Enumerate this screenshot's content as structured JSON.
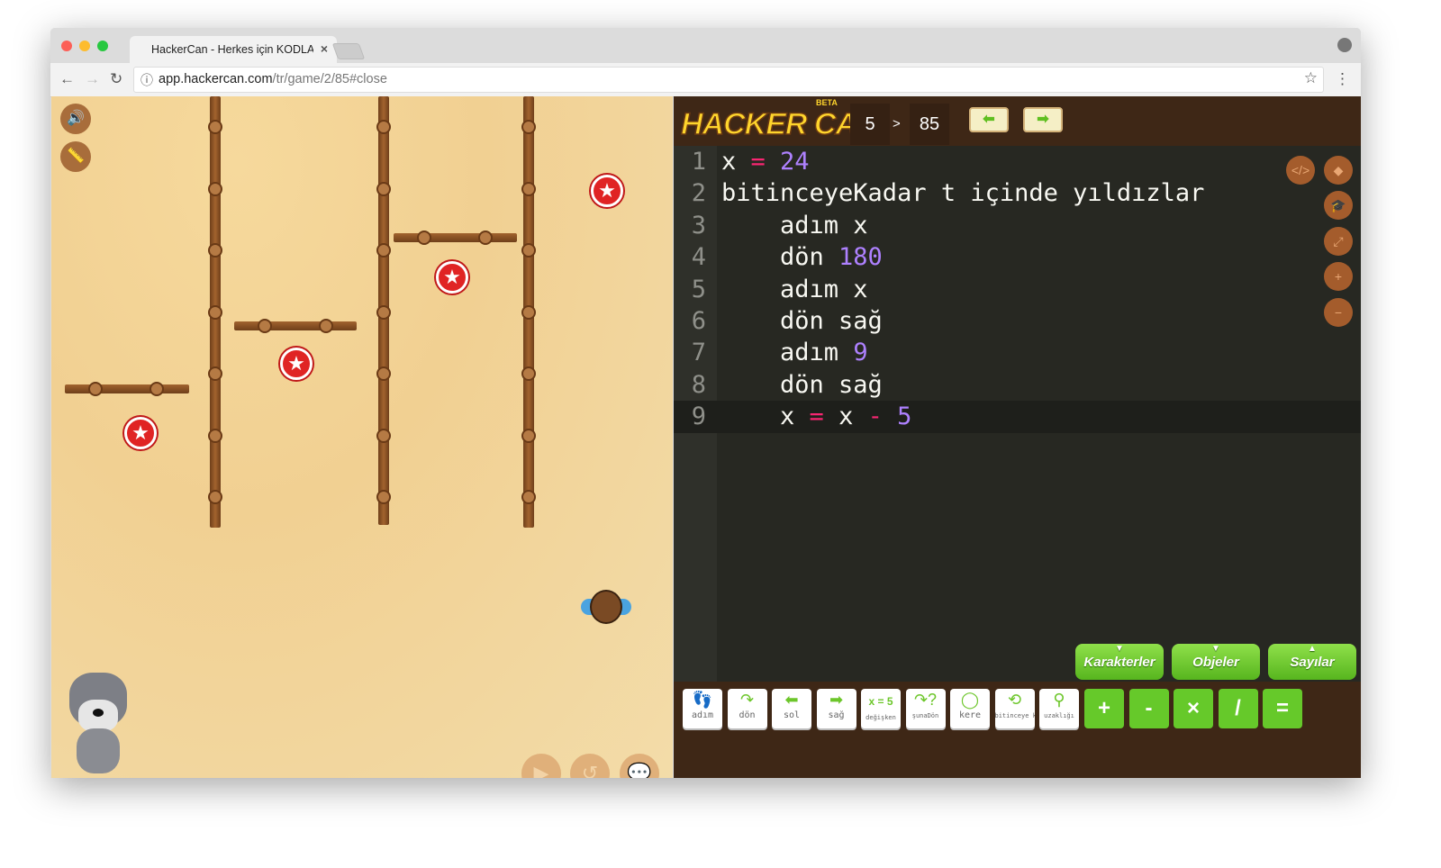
{
  "browser": {
    "tab_title": "HackerCan - Herkes için KODLAMA",
    "url_host": "app.hackercan.com",
    "url_path": "/tr/game/2/85#close"
  },
  "header": {
    "logo": "HACKER CAN",
    "beta": "BETA",
    "level_world": "5",
    "separator": ">",
    "level_number": "85"
  },
  "code": {
    "lines": [
      {
        "n": "1",
        "parts": [
          [
            "x",
            ""
          ],
          [
            " = ",
            "op"
          ],
          [
            "24",
            "kw"
          ]
        ]
      },
      {
        "n": "2",
        "parts": [
          [
            "bitinceyeKadar t içinde yıldızlar",
            ""
          ]
        ]
      },
      {
        "n": "3",
        "parts": [
          [
            "    adım x",
            ""
          ]
        ]
      },
      {
        "n": "4",
        "parts": [
          [
            "    dön ",
            ""
          ],
          [
            "180",
            "kw"
          ]
        ]
      },
      {
        "n": "5",
        "parts": [
          [
            "    adım x",
            ""
          ]
        ]
      },
      {
        "n": "6",
        "parts": [
          [
            "    dön sağ",
            ""
          ]
        ]
      },
      {
        "n": "7",
        "parts": [
          [
            "    adım ",
            ""
          ],
          [
            "9",
            "kw"
          ]
        ]
      },
      {
        "n": "8",
        "parts": [
          [
            "    dön sağ",
            ""
          ]
        ]
      },
      {
        "n": "9",
        "parts": [
          [
            "    x ",
            ""
          ],
          [
            "=",
            "op"
          ],
          [
            " x ",
            ""
          ],
          [
            "-",
            "op"
          ],
          [
            " 5",
            "kw"
          ]
        ]
      }
    ],
    "active_line": 9
  },
  "categories": [
    {
      "label": "Karakterler",
      "arrow": "▼"
    },
    {
      "label": "Objeler",
      "arrow": "▼"
    },
    {
      "label": "Sayılar",
      "arrow": "▲"
    }
  ],
  "blocks": [
    {
      "icon": "👣",
      "label": "adım"
    },
    {
      "icon": "↷",
      "label": "dön"
    },
    {
      "icon": "⬅",
      "label": "sol"
    },
    {
      "icon": "➡",
      "label": "sağ"
    },
    {
      "icon": "x = 5",
      "label": "değişken"
    },
    {
      "icon": "↷?",
      "label": "şunaDön"
    },
    {
      "icon": "◯",
      "label": "kere"
    },
    {
      "icon": "⟲",
      "label": "bitinceye kadar"
    },
    {
      "icon": "⚲",
      "label": "uzaklığı"
    }
  ],
  "operators": [
    "+",
    "-",
    "×",
    "/",
    "="
  ],
  "colors": {
    "accent": "#66c92a",
    "panel": "#3e2716",
    "editor": "#272822",
    "number": "#ae81ff",
    "operator": "#f92672"
  }
}
